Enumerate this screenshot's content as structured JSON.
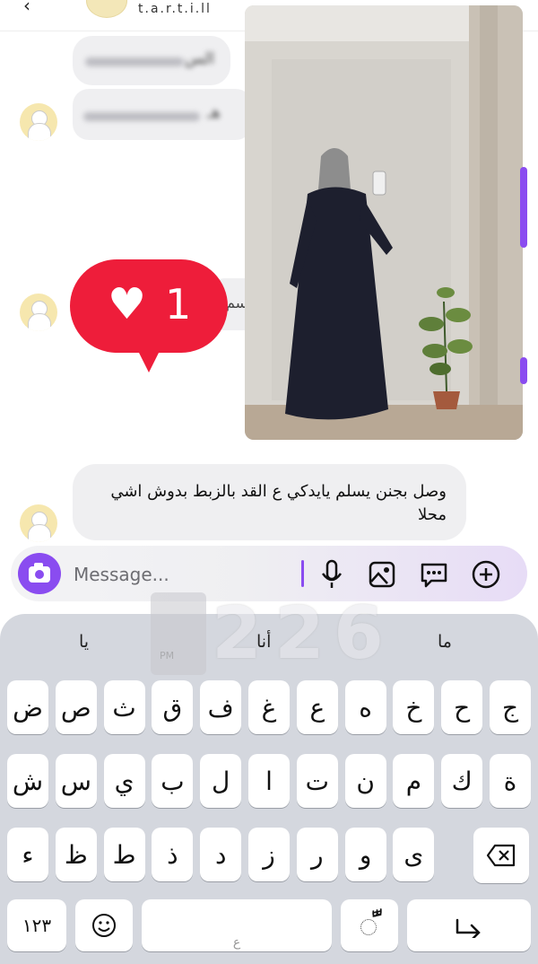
{
  "header": {
    "username": "t.a.r.t.i.ll",
    "back_icon": "chevron-left-icon"
  },
  "messages": {
    "blurred_1": "الس",
    "blurred_2": "هـ",
    "blurred_3": "سم",
    "reply": "وصل بجنن يسلم يايدكي ع القد بالزبط بدوش اشي محلا"
  },
  "reaction": {
    "icon": "heart-icon",
    "count": "1",
    "color": "#ee1d3a"
  },
  "composer": {
    "placeholder": "Message...",
    "accent": "#8a4cf0"
  },
  "clock_overlay": {
    "d1": "2",
    "d2": "2",
    "d3": "6",
    "period": "PM"
  },
  "keyboard": {
    "suggestions": [
      "يا",
      "أنا",
      "ما"
    ],
    "row1": [
      "ض",
      "ص",
      "ث",
      "ق",
      "ف",
      "غ",
      "ع",
      "ه",
      "خ",
      "ح",
      "ج"
    ],
    "row2": [
      "ش",
      "س",
      "ي",
      "ب",
      "ل",
      "ا",
      "ت",
      "ن",
      "م",
      "ك",
      "ة"
    ],
    "row3": [
      "ء",
      "ظ",
      "ط",
      "ذ",
      "د",
      "ز",
      "ر",
      "و",
      "ى"
    ],
    "numbers_key": "١٢٣",
    "space_hint": "ع",
    "diacritic_key": "ًّ"
  }
}
